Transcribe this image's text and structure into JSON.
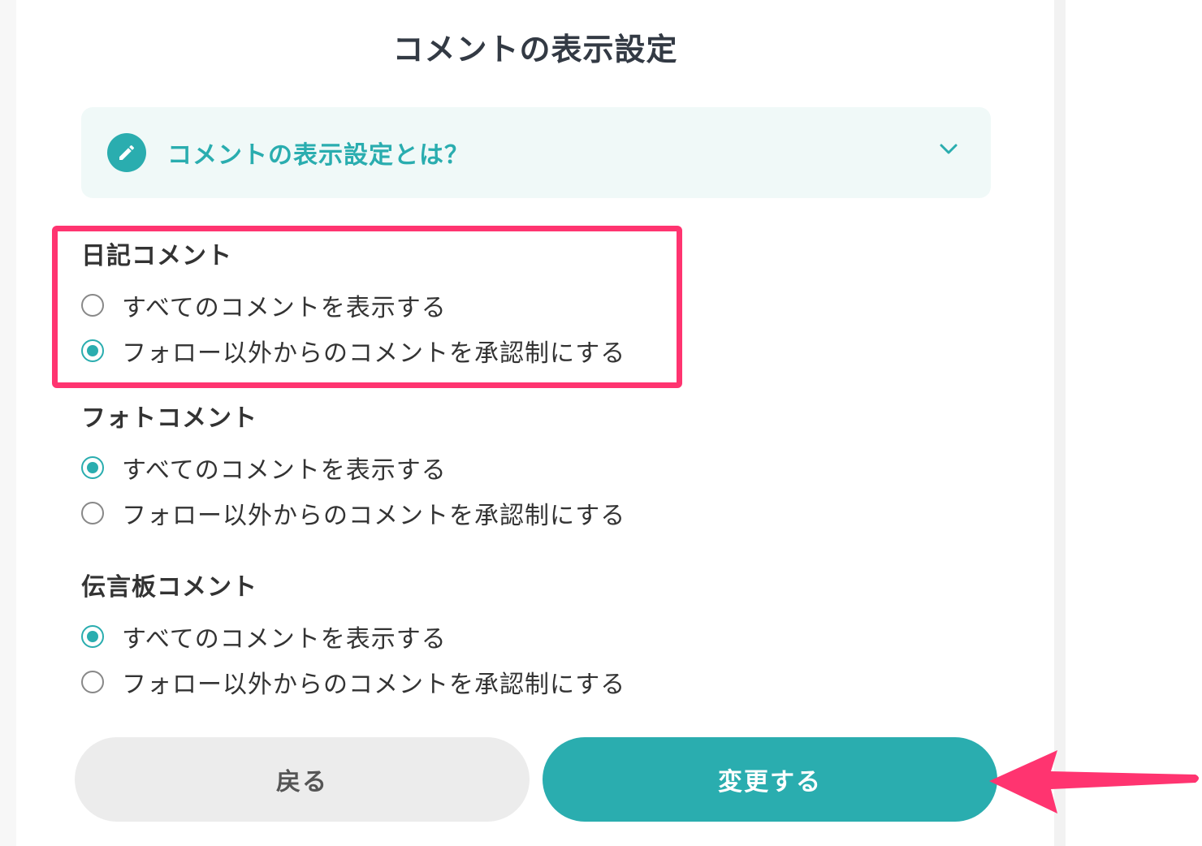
{
  "page": {
    "title": "コメントの表示設定"
  },
  "help": {
    "label": "コメントの表示設定とは？",
    "icon": "pencil-icon",
    "toggle_icon": "chevron-down-icon",
    "accent_color": "#2aadaf"
  },
  "sections": [
    {
      "title": "日記コメント",
      "options": [
        {
          "label": "すべてのコメントを表示する",
          "checked": false
        },
        {
          "label": "フォロー以外からのコメントを承認制にする",
          "checked": true
        }
      ]
    },
    {
      "title": "フォトコメント",
      "options": [
        {
          "label": "すべてのコメントを表示する",
          "checked": true
        },
        {
          "label": "フォロー以外からのコメントを承認制にする",
          "checked": false
        }
      ]
    },
    {
      "title": "伝言板コメント",
      "options": [
        {
          "label": "すべてのコメントを表示する",
          "checked": true
        },
        {
          "label": "フォロー以外からのコメントを承認制にする",
          "checked": false
        }
      ]
    }
  ],
  "buttons": {
    "back_label": "戻る",
    "submit_label": "変更する"
  },
  "annotations": {
    "highlight_color": "#ff3470",
    "arrow_color": "#ff3470"
  }
}
